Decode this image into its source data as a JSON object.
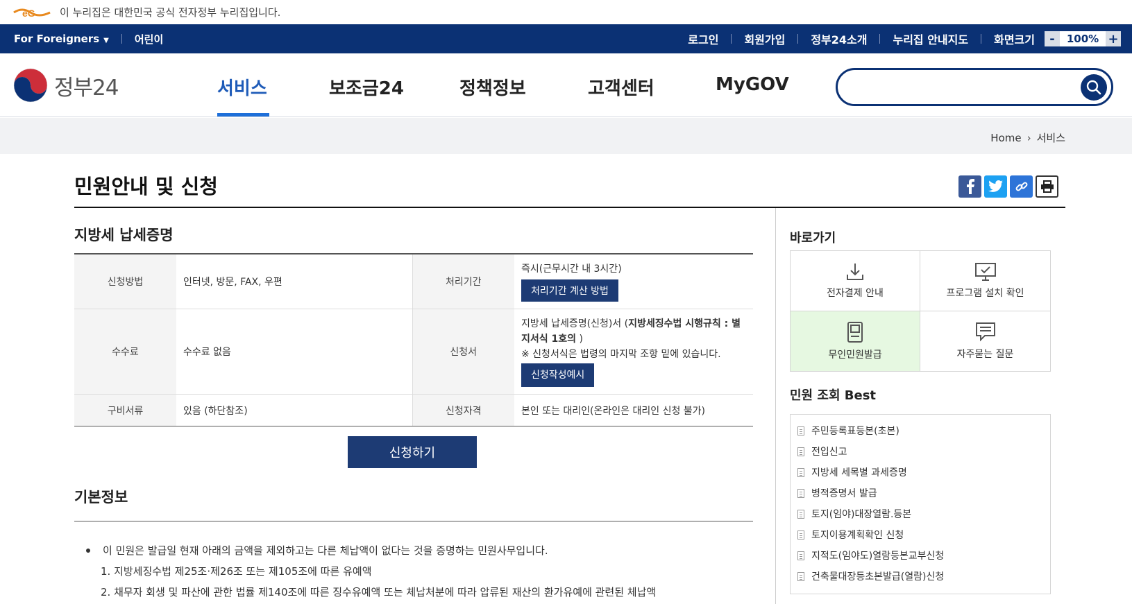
{
  "notice": {
    "text": "이 누리집은 대한민국 공식 전자정부 누리집입니다."
  },
  "utilbar": {
    "foreigners": "For Foreigners",
    "kids": "어린이",
    "links": [
      "로그인",
      "회원가입",
      "정부24소개",
      "누리집 안내지도",
      "화면크기"
    ],
    "zoom_minus": "-",
    "zoom_value": "100%",
    "zoom_plus": "+"
  },
  "header": {
    "brand": "정부24",
    "nav": [
      "서비스",
      "보조금24",
      "정책정보",
      "고객센터",
      "MyGOV"
    ],
    "active_nav": "서비스",
    "search_placeholder": ""
  },
  "breadcrumb": {
    "home": "Home",
    "current": "서비스"
  },
  "page": {
    "title": "민원안내 및 신청"
  },
  "service": {
    "title": "지방세 납세증명",
    "rows": [
      {
        "h1": "신청방법",
        "v1": "인터넷, 방문, FAX, 우편",
        "h2": "처리기간",
        "v2": "즉시(근무시간 내 3시간)",
        "v2_button": "처리기간 계산 방법"
      },
      {
        "h1": "수수료",
        "v1": "수수료 없음",
        "h2": "신청서",
        "v2_pre": "지방세 납세증명(신청)서 (",
        "v2_bold": "지방세징수법 시행규칙 : 별지서식 1호의",
        "v2_post": " )",
        "v2_note": "※ 신청서식은 법령의 마지막 조항 밑에 있습니다.",
        "v2_button": "신청작성예시"
      },
      {
        "h1": "구비서류",
        "v1": "있음 (하단참조)",
        "h2": "신청자격",
        "v2": "본인 또는 대리인(온라인은 대리인 신청 불가)"
      }
    ],
    "apply_button": "신청하기"
  },
  "basic": {
    "title": "기본정보",
    "bullet": "이 민원은 발급일 현재 아래의 금액을 제외하고는 다른 체납액이 없다는 것을 증명하는 민원사무입니다.",
    "items": [
      "1. 지방세징수법 제25조·제26조 또는 제105조에 따른 유예액",
      "2. 채무자 회생 및 파산에 관한 법률 제140조에 따른 징수유예액 또는 체납처분에 따라 압류된 재산의 환가유예에 관련된 체납액"
    ]
  },
  "sidebar": {
    "quick_title": "바로가기",
    "quick": [
      "전자결제 안내",
      "프로그램 설치 확인",
      "무인민원발급",
      "자주묻는 질문"
    ],
    "best_title": "민원 조회 Best",
    "best": [
      "주민등록표등본(초본)",
      "전입신고",
      "지방세 세목별 과세증명",
      "병적증명서 발급",
      "토지(임야)대장열람.등본",
      "토지이용계획확인 신청",
      "지적도(임야도)열람등본교부신청",
      "건축물대장등초본발급(열람)신청"
    ]
  },
  "colors": {
    "navy": "#0b3174",
    "accent_blue": "#1e5bb8",
    "button_navy": "#1d3b74",
    "highlight_green": "#e6f8e1"
  }
}
